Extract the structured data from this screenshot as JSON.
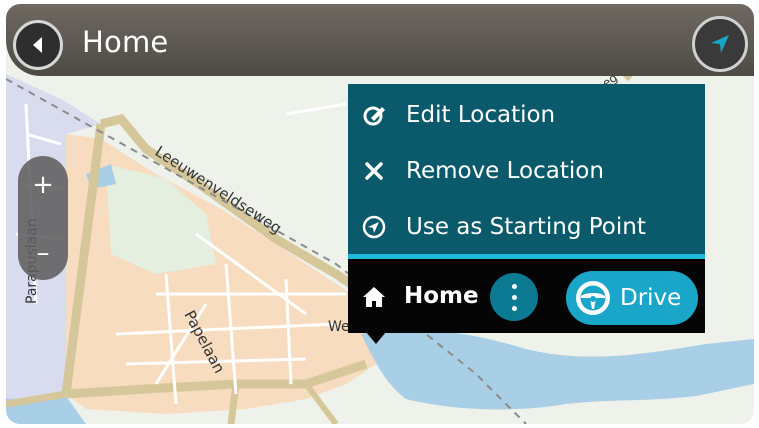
{
  "header": {
    "title": "Home"
  },
  "map": {
    "street_labels": [
      "Leeuwenveldseweg",
      "Papelaan",
      "Parapuslaan",
      "We",
      "eg"
    ]
  },
  "zoom": {
    "in_label": "+",
    "out_label": "–"
  },
  "popup": {
    "items": [
      {
        "label": "Edit Location",
        "icon": "edit-icon"
      },
      {
        "label": "Remove Location",
        "icon": "close-icon"
      },
      {
        "label": "Use as Starting Point",
        "icon": "navigation-arrow-icon"
      }
    ]
  },
  "location_bar": {
    "name": "Home",
    "drive_label": "Drive"
  },
  "colors": {
    "popup_bg": "#0b5a6c",
    "accent": "#1aa6c8",
    "location_bar_bg": "#050505"
  }
}
